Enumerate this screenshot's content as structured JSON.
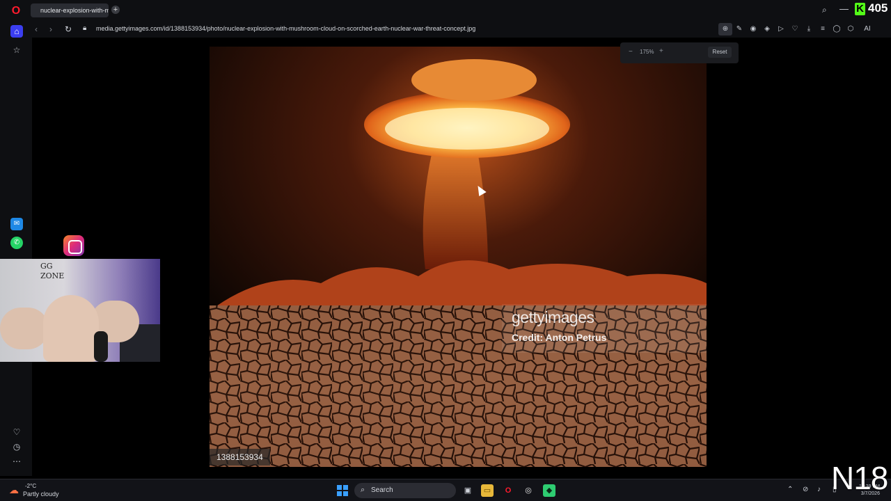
{
  "browser": {
    "tab_title": "nuclear-explosion-with-m",
    "new_tab_label": "+",
    "url": "media.gettyimages.com/id/1388153934/photo/nuclear-explosion-with-mushroom-cloud-on-scorched-earth-nuclear-war-threat-concept.jpg",
    "zoom": {
      "minus_label": "−",
      "value": "175%",
      "plus_label": "+",
      "reset_label": "Reset"
    },
    "kick_count": "405",
    "ai_label": "AI"
  },
  "image": {
    "watermark_brand": "gettyimages",
    "watermark_credit": "Credit: Anton Petrus",
    "image_id": "1388153934"
  },
  "webcam": {
    "sign_text": "GG\nZONE"
  },
  "taskbar": {
    "weather_temp": "-2°C",
    "weather_desc": "Partly cloudy",
    "search_placeholder": "Search",
    "time": "12:39 PM",
    "date": "3/7/2026"
  },
  "overlay": {
    "channel_logo": "N18"
  },
  "colors": {
    "opera_red": "#ff1b2d",
    "kick_green": "#53fc18",
    "sidebar_home_accent": "#3b3ef0"
  }
}
